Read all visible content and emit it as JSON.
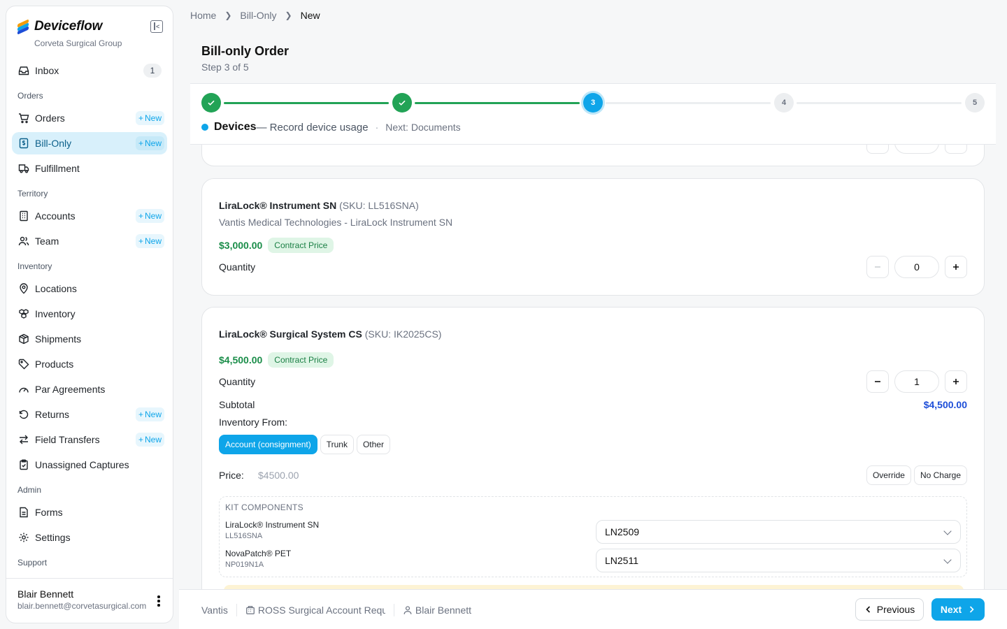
{
  "app": {
    "name": "Deviceflow",
    "org": "Corveta Surgical Group"
  },
  "sidebar": {
    "inbox": {
      "label": "Inbox",
      "count": "1"
    },
    "new_label": "New",
    "sections": {
      "orders": "Orders",
      "territory": "Territory",
      "inventory": "Inventory",
      "admin": "Admin",
      "support": "Support"
    },
    "items": {
      "orders": "Orders",
      "bill_only": "Bill-Only",
      "fulfillment": "Fulfillment",
      "accounts": "Accounts",
      "team": "Team",
      "locations": "Locations",
      "inventory": "Inventory",
      "shipments": "Shipments",
      "products": "Products",
      "par_agreements": "Par Agreements",
      "returns": "Returns",
      "field_transfers": "Field Transfers",
      "unassigned_captures": "Unassigned Captures",
      "forms": "Forms",
      "settings": "Settings"
    },
    "active": "Bill-Only"
  },
  "user": {
    "name": "Blair Bennett",
    "email": "blair.bennett@corvetasurgical.com"
  },
  "breadcrumb": [
    "Home",
    "Bill-Only",
    "New"
  ],
  "page": {
    "title": "Bill-only Order",
    "subtitle": "Step 3 of 5"
  },
  "stepper": {
    "steps": [
      "1",
      "2",
      "3",
      "4",
      "5"
    ],
    "current_step": 3,
    "current_name": "Devices",
    "current_desc": "— Record device usage",
    "next": "Next: Documents"
  },
  "devices": [
    {
      "name": "LiraLock® Instrument SN",
      "sku": "(SKU: LL516SNA)",
      "vendor": "Vantis Medical Technologies - LiraLock Instrument SN",
      "price": "$3,000.00",
      "price_tag": "Contract Price",
      "quantity_label": "Quantity",
      "quantity": "0"
    },
    {
      "name": "LiraLock® Surgical System CS",
      "sku": "(SKU: IK2025CS)",
      "price": "$4,500.00",
      "price_tag": "Contract Price",
      "quantity_label": "Quantity",
      "quantity": "1",
      "subtotal_label": "Subtotal",
      "subtotal": "$4,500.00",
      "inventory_from_label": "Inventory From:",
      "inventory_options": [
        "Account (consignment)",
        "Trunk",
        "Other"
      ],
      "inventory_selected": "Account (consignment)",
      "price_label": "Price:",
      "price_value": "$4500.00",
      "price_actions": [
        "Override",
        "No Charge"
      ],
      "kit": {
        "title": "KIT COMPONENTS",
        "components": [
          {
            "name": "LiraLock® Instrument SN",
            "sku": "LL516SNA",
            "lot": "LN2509"
          },
          {
            "name": "NovaPatch® PET",
            "sku": "NP019N1A",
            "lot": "LN2511"
          }
        ]
      }
    }
  ],
  "footer": {
    "vendor": "Vantis",
    "account": "ROSS Surgical Account Request",
    "rep": "Blair Bennett",
    "previous": "Previous",
    "next": "Next"
  },
  "colors": {
    "accent": "#0ea5e9",
    "success": "#22a356",
    "price": "#1a8d49",
    "subtotal": "#1d4ed8"
  }
}
